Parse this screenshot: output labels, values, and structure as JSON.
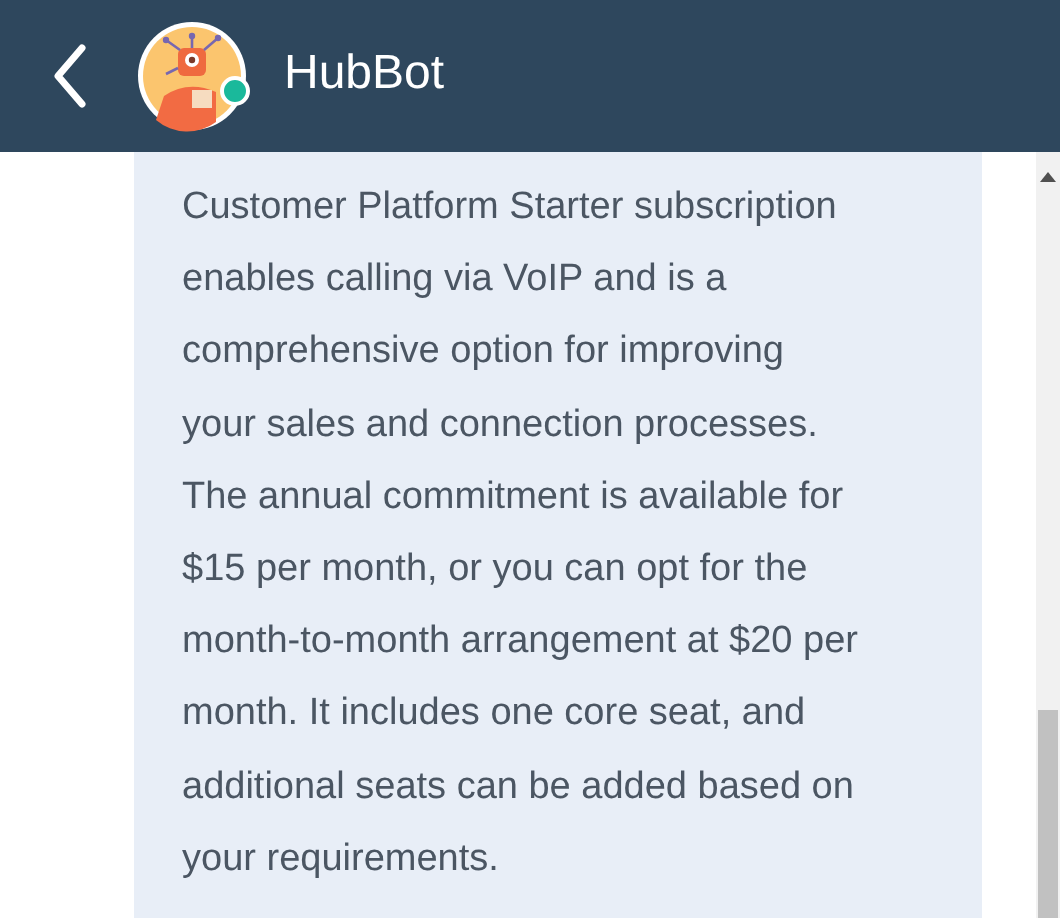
{
  "header": {
    "title": "HubBot",
    "online": true
  },
  "message": {
    "lines": [
      "Customer Platform Starter subscription",
      "enables calling via VoIP and is a",
      "comprehensive option for improving",
      "your sales and connection processes.",
      "The annual commitment is available for",
      "$15 per month, or you can opt for the",
      "month-to-month arrangement at $20 per",
      "month. It includes one core seat, and",
      "additional seats can be added based on",
      "your requirements."
    ]
  }
}
